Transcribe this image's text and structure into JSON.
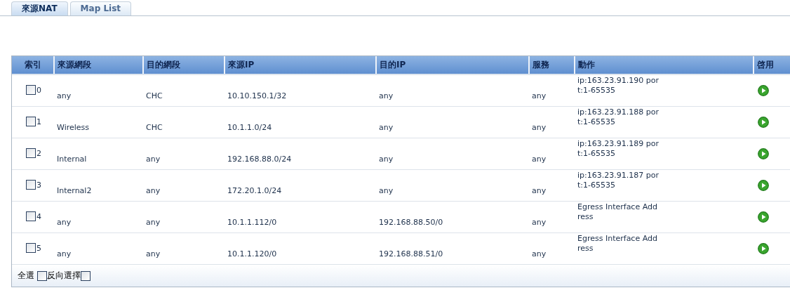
{
  "tabs": [
    {
      "label": "來源NAT",
      "selected": true
    },
    {
      "label": "Map List",
      "selected": false
    }
  ],
  "table": {
    "columns": [
      "索引",
      "來源網段",
      "目的網段",
      "來源IP",
      "目的IP",
      "服務",
      "動作",
      "啓用"
    ],
    "rows": [
      {
        "index": "0",
        "checked": false,
        "source_zone": "any",
        "dest_zone": "CHC",
        "source_ip": "10.10.150.1/32",
        "dest_ip": "any",
        "service": "any",
        "action": [
          "ip:163.23.91.190 por",
          "t:1-65535"
        ],
        "enabled": true
      },
      {
        "index": "1",
        "checked": false,
        "source_zone": "Wireless",
        "dest_zone": "CHC",
        "source_ip": "10.1.1.0/24",
        "dest_ip": "any",
        "service": "any",
        "action": [
          "ip:163.23.91.188 por",
          "t:1-65535"
        ],
        "enabled": true
      },
      {
        "index": "2",
        "checked": false,
        "source_zone": "Internal",
        "dest_zone": "any",
        "source_ip": "192.168.88.0/24",
        "dest_ip": "any",
        "service": "any",
        "action": [
          "ip:163.23.91.189 por",
          "t:1-65535"
        ],
        "enabled": true
      },
      {
        "index": "3",
        "checked": false,
        "source_zone": "Internal2",
        "dest_zone": "any",
        "source_ip": "172.20.1.0/24",
        "dest_ip": "any",
        "service": "any",
        "action": [
          "ip:163.23.91.187 por",
          "t:1-65535"
        ],
        "enabled": true
      },
      {
        "index": "4",
        "checked": false,
        "source_zone": "any",
        "dest_zone": "any",
        "source_ip": "10.1.1.112/0",
        "dest_ip": "192.168.88.50/0",
        "service": "any",
        "action": [
          "Egress Interface Add",
          "ress"
        ],
        "enabled": true
      },
      {
        "index": "5",
        "checked": false,
        "source_zone": "any",
        "dest_zone": "any",
        "source_ip": "10.1.1.120/0",
        "dest_ip": "192.168.88.51/0",
        "service": "any",
        "action": [
          "Egress Interface Add",
          "ress"
        ],
        "enabled": true
      }
    ]
  },
  "footer": {
    "select_all": {
      "label": "全選",
      "checked": false
    },
    "invert": {
      "label": "反向選擇",
      "checked": false
    }
  }
}
